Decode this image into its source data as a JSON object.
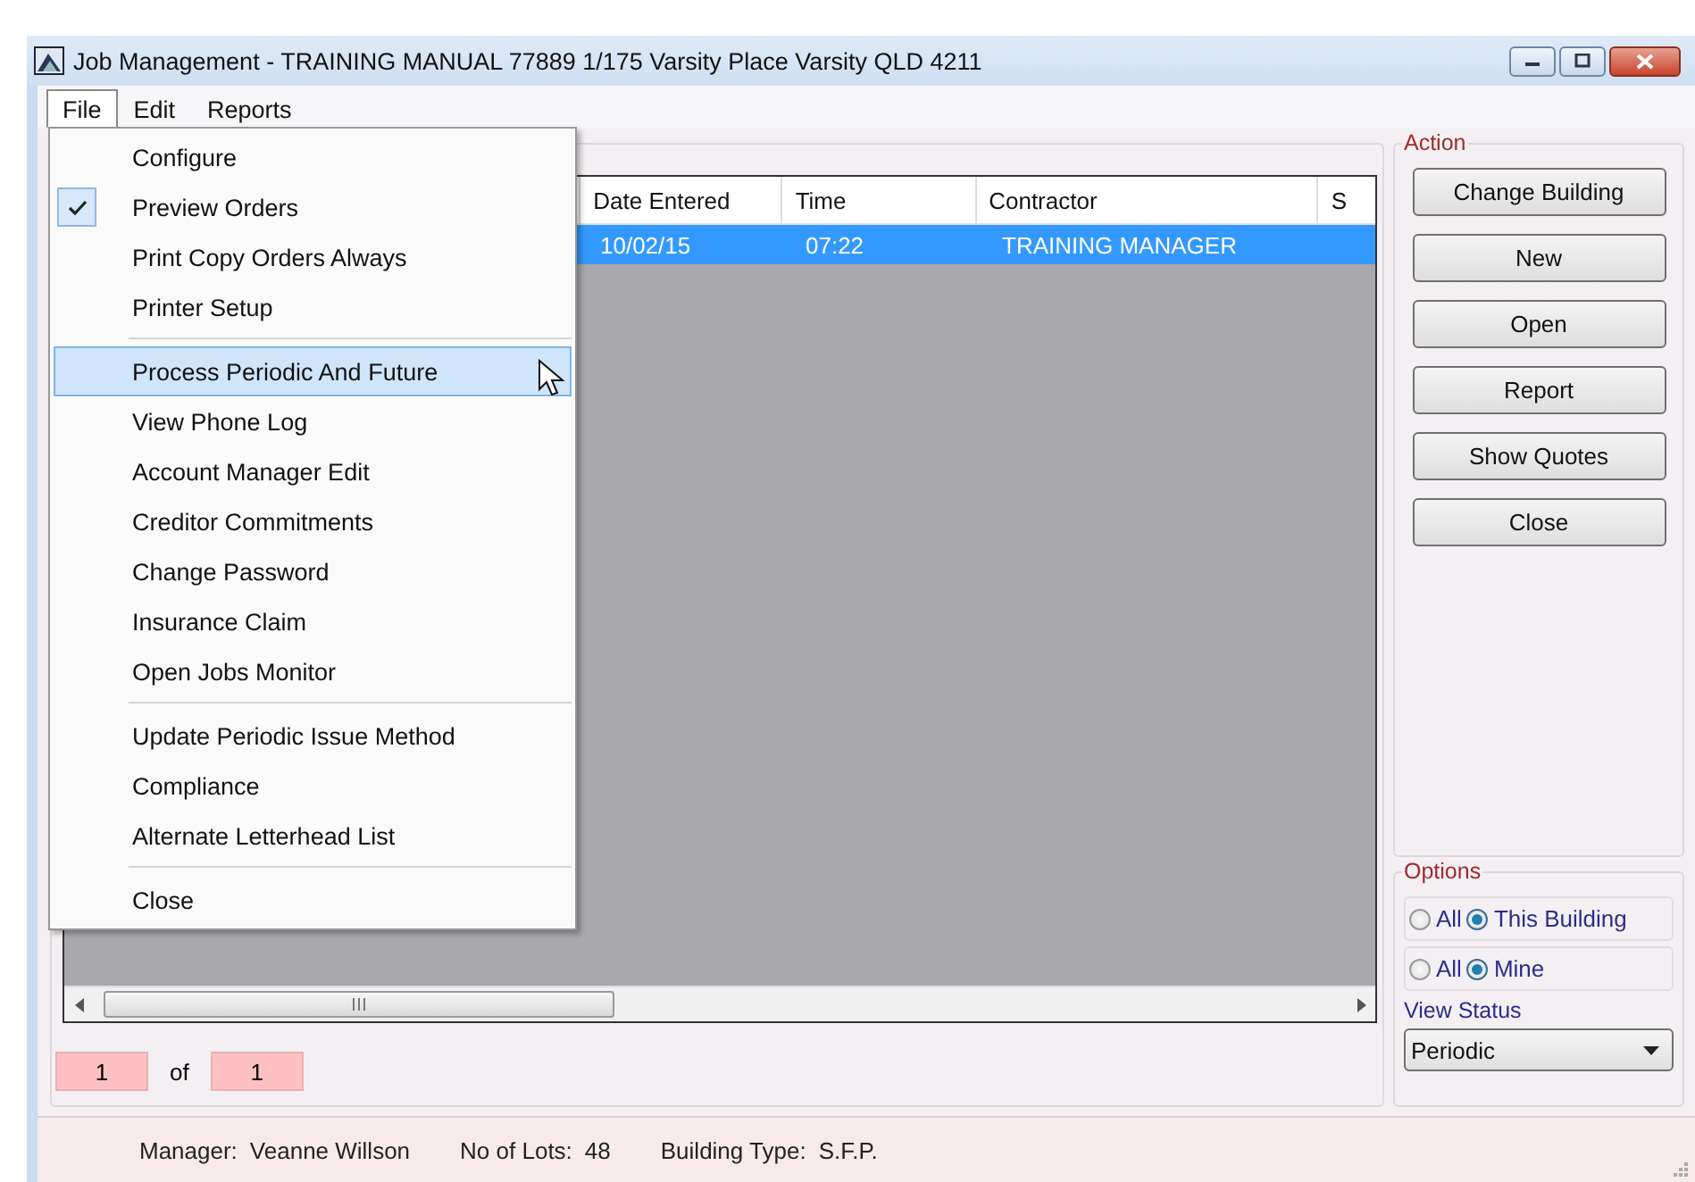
{
  "window": {
    "title": "Job Management - TRAINING MANUAL 77889 1/175 Varsity Place  Varsity QLD 4211"
  },
  "menu_bar": [
    {
      "label": "File",
      "selected": true
    },
    {
      "label": "Edit",
      "selected": false
    },
    {
      "label": "Reports",
      "selected": false
    }
  ],
  "file_menu": {
    "sections": [
      {
        "items": [
          {
            "label": "Configure",
            "checked": false,
            "selected": false
          },
          {
            "label": "Preview Orders",
            "checked": true,
            "selected": false
          },
          {
            "label": "Print Copy Orders Always",
            "checked": false,
            "selected": false
          },
          {
            "label": "Printer Setup",
            "checked": false,
            "selected": false
          }
        ]
      },
      {
        "items": [
          {
            "label": "Process Periodic And Future",
            "checked": false,
            "selected": true
          },
          {
            "label": "View Phone Log",
            "checked": false,
            "selected": false
          },
          {
            "label": "Account Manager Edit",
            "checked": false,
            "selected": false
          },
          {
            "label": "Creditor Commitments",
            "checked": false,
            "selected": false
          },
          {
            "label": "Change Password",
            "checked": false,
            "selected": false
          },
          {
            "label": "Insurance Claim",
            "checked": false,
            "selected": false
          },
          {
            "label": "Open Jobs Monitor",
            "checked": false,
            "selected": false
          }
        ]
      },
      {
        "items": [
          {
            "label": "Update Periodic Issue Method",
            "checked": false,
            "selected": false
          },
          {
            "label": "Compliance",
            "checked": false,
            "selected": false
          },
          {
            "label": "Alternate Letterhead List",
            "checked": false,
            "selected": false
          }
        ]
      },
      {
        "items": [
          {
            "label": "Close",
            "checked": false,
            "selected": false
          }
        ]
      }
    ]
  },
  "table": {
    "columns": [
      "Date Entered",
      "Time",
      "Contractor",
      "S"
    ],
    "rows": [
      {
        "cells": [
          "10/02/15",
          "07:22",
          "TRAINING MANAGER"
        ],
        "selected": true
      }
    ]
  },
  "pager": {
    "current": "1",
    "separator": "of",
    "total": "1"
  },
  "action": {
    "title": "Action",
    "buttons": [
      "Change Building",
      "New",
      "Open",
      "Report",
      "Show Quotes",
      "Close"
    ]
  },
  "options": {
    "title": "Options",
    "radio_groups": [
      {
        "options": [
          {
            "label": "All",
            "selected": false
          },
          {
            "label": "This Building",
            "selected": true
          }
        ]
      },
      {
        "options": [
          {
            "label": "All",
            "selected": false
          },
          {
            "label": "Mine",
            "selected": true
          }
        ]
      }
    ],
    "view_status": {
      "label": "View Status",
      "value": "Periodic"
    }
  },
  "status_bar": [
    {
      "label": "Manager:",
      "value": "Veanne Willson"
    },
    {
      "label": "No of Lots:",
      "value": "48"
    },
    {
      "label": "Building Type:",
      "value": "S.F.P."
    }
  ]
}
